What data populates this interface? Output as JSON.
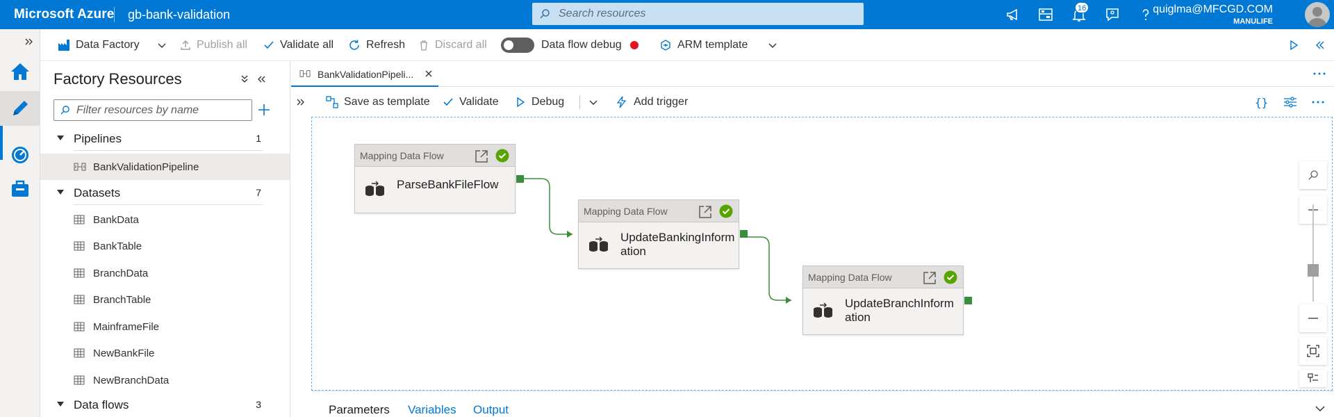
{
  "header": {
    "brand": "Microsoft Azure",
    "factory_name": "gb-bank-validation",
    "search_placeholder": "Search resources",
    "notification_count": "16",
    "user_email": "quiglma@MFCGD.COM",
    "user_tenant": "MANULIFE",
    "accent_color": "#0078d4"
  },
  "commandbar": {
    "data_factory": "Data Factory",
    "publish_all": "Publish all",
    "validate_all": "Validate all",
    "refresh": "Refresh",
    "discard_all": "Discard all",
    "data_flow_debug": "Data flow debug",
    "arm_template": "ARM template"
  },
  "resources": {
    "title": "Factory Resources",
    "filter_placeholder": "Filter resources by name",
    "sections": [
      {
        "label": "Pipelines",
        "count": "1",
        "items": [
          "BankValidationPipeline"
        ]
      },
      {
        "label": "Datasets",
        "count": "7",
        "items": [
          "BankData",
          "BankTable",
          "BranchData",
          "BranchTable",
          "MainframeFile",
          "NewBankFile",
          "NewBranchData"
        ]
      },
      {
        "label": "Data flows",
        "count": "3",
        "items": []
      }
    ]
  },
  "tab": {
    "label": "BankValidationPipeli..."
  },
  "pipeline_toolbar": {
    "save_as_template": "Save as template",
    "validate": "Validate",
    "debug": "Debug",
    "add_trigger": "Add trigger"
  },
  "activities": [
    {
      "type_label": "Mapping Data Flow",
      "name": "ParseBankFileFlow",
      "status": "succeeded"
    },
    {
      "type_label": "Mapping Data Flow",
      "name": "UpdateBankingInformation",
      "status": "succeeded"
    },
    {
      "type_label": "Mapping Data Flow",
      "name": "UpdateBranchInformation",
      "status": "succeeded"
    }
  ],
  "bottom_tabs": {
    "parameters": "Parameters",
    "variables": "Variables",
    "output": "Output"
  },
  "colors": {
    "success": "#57a300",
    "port": "#3a8d3a",
    "debug_dot": "#e81123"
  }
}
